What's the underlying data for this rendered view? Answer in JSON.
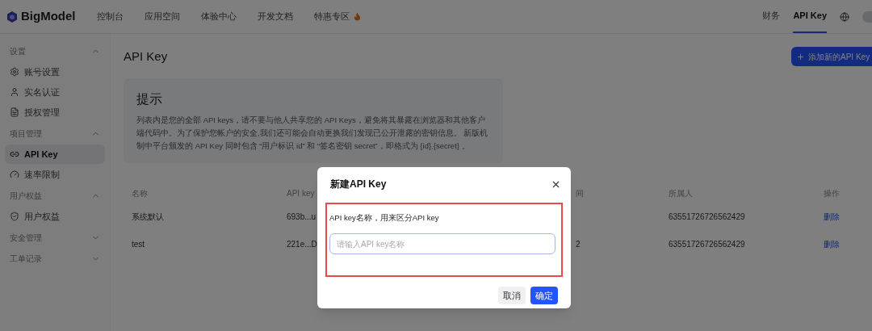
{
  "header": {
    "brand": "BigModel",
    "nav": [
      {
        "label": "控制台"
      },
      {
        "label": "应用空间"
      },
      {
        "label": "体验中心"
      },
      {
        "label": "开发文档"
      },
      {
        "label": "特惠专区",
        "hot": true
      }
    ],
    "right_nav": [
      {
        "label": "财务",
        "selected": false
      },
      {
        "label": "API Key",
        "selected": true
      }
    ]
  },
  "sidebar": {
    "sections": [
      {
        "title": "设置",
        "expanded": true,
        "items": [
          {
            "label": "账号设置",
            "selected": false
          },
          {
            "label": "实名认证",
            "selected": false
          },
          {
            "label": "授权管理",
            "selected": false
          }
        ]
      },
      {
        "title": "项目管理",
        "expanded": true,
        "items": [
          {
            "label": "API Key",
            "selected": true
          },
          {
            "label": "速率限制",
            "selected": false
          }
        ]
      },
      {
        "title": "用户权益",
        "expanded": true,
        "items": [
          {
            "label": "用户权益",
            "selected": false
          }
        ]
      },
      {
        "title": "安全管理",
        "expanded": false
      },
      {
        "title": "工单记录",
        "expanded": false
      }
    ]
  },
  "page": {
    "title": "API Key",
    "add_button": "添加新的API Key",
    "tip": {
      "title": "提示",
      "text": "列表内是您的全部 API keys，请不要与他人共享您的 API Keys，避免将其暴露在浏览器和其他客户端代码中。为了保护您帐户的安全,我们还可能会自动更换我们发现已公开泄露的密钥信息。 新版机制中平台颁发的 API Key 同时包含 “用户标识 id” 和 “签名密钥 secret”，即格式为 {id}.{secret} 。"
    },
    "table": {
      "columns": [
        "名称",
        "API key",
        "间",
        "所属人",
        "操作"
      ],
      "rows": [
        {
          "cells": [
            "系统默认",
            "693b...u",
            "",
            "63551726726562429"
          ],
          "action": "删除"
        },
        {
          "cells": [
            "test",
            "221e...D",
            "2",
            "63551726726562429"
          ],
          "action": "删除"
        }
      ]
    }
  },
  "dialog": {
    "title": "新建API Key",
    "label": "API key名称，用来区分API key",
    "placeholder": "请输入API key名称",
    "cancel": "取消",
    "confirm": "确定"
  }
}
